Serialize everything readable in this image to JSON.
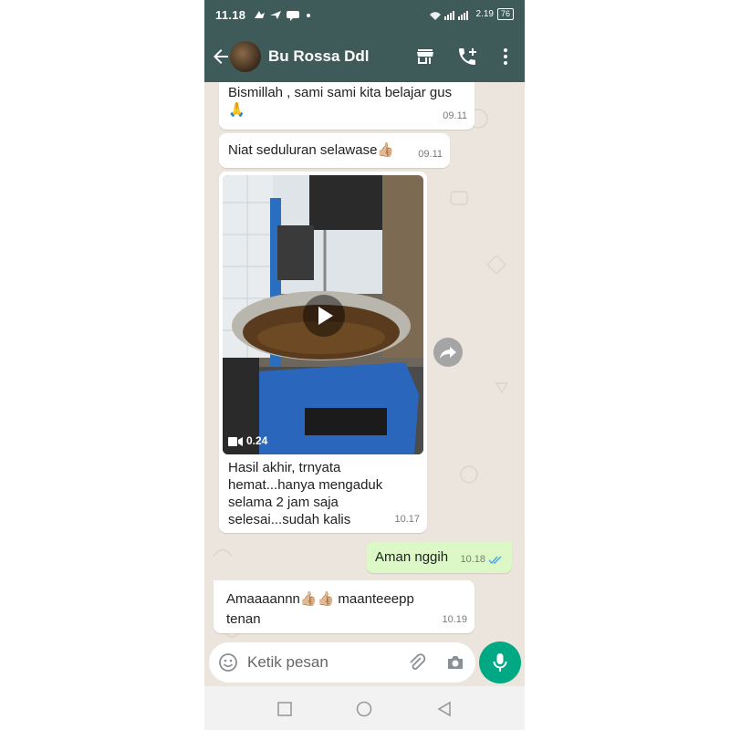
{
  "status": {
    "time": "11.18",
    "net": "2.19",
    "battery": "76"
  },
  "header": {
    "contact_name": "Bu Rossa Ddl"
  },
  "messages": [
    {
      "text": "Bismillah , sami sami kita belajar gus 🙏",
      "time": "09.11"
    },
    {
      "text": "Niat seduluran selawase👍🏼",
      "time": "09.11"
    },
    {
      "video_duration": "0.24",
      "caption": "Hasil akhir, trnyata hemat...hanya mengaduk selama 2 jam saja selesai...sudah kalis",
      "time": "10.17"
    },
    {
      "text": "Aman nggih",
      "time": "10.18"
    },
    {
      "text": "Amaaaannn👍🏼👍🏼 maanteeepp tenan",
      "time": "10.19"
    }
  ],
  "composer": {
    "placeholder": "Ketik pesan"
  },
  "colors": {
    "header": "#3e5a59",
    "chat_bg": "#ece5dd",
    "outgoing": "#dcf8c6",
    "accent": "#00a884",
    "tick": "#4fa6e0"
  },
  "icons": [
    "back-arrow-icon",
    "shop-icon",
    "add-call-icon",
    "more-vert-icon",
    "play-icon",
    "video-camera-icon",
    "share-icon",
    "emoji-icon",
    "attach-icon",
    "camera-icon",
    "mic-icon",
    "read-tick-icon",
    "nav-square-icon",
    "nav-circle-icon",
    "nav-triangle-icon"
  ]
}
